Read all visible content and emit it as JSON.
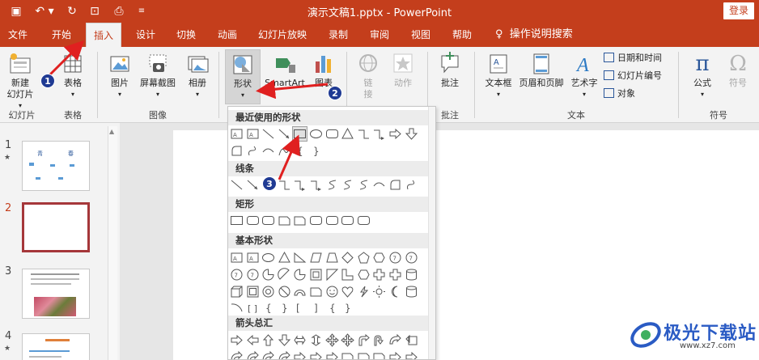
{
  "app": {
    "document_title": "演示文稿1.pptx  -  PowerPoint",
    "login_label": "登录"
  },
  "tabs": [
    "文件",
    "开始",
    "插入",
    "设计",
    "切换",
    "动画",
    "幻灯片放映",
    "录制",
    "审阅",
    "视图",
    "帮助"
  ],
  "tell_me": "操作说明搜索",
  "ribbon": {
    "new_slide": "新建\n幻灯片",
    "table": "表格",
    "picture": "图片",
    "screenshot": "屏幕截图",
    "album": "相册",
    "shapes": "形状",
    "smartart": "SmartArt",
    "chart": "图表",
    "link": "链\n接",
    "action": "动作",
    "comment": "批注",
    "textbox": "文本框",
    "header_footer": "页眉和页脚",
    "wordart": "艺术字",
    "date_time": "日期和时间",
    "slide_number": "幻灯片编号",
    "object": "对象",
    "equation": "公式",
    "symbol": "符号",
    "groups": {
      "slides": "幻灯片",
      "tables": "表格",
      "images": "图像",
      "comments": "批注",
      "text": "文本",
      "symbols": "符号"
    }
  },
  "gallery": {
    "sections": [
      "最近使用的形状",
      "线条",
      "矩形",
      "基本形状",
      "箭头总汇"
    ]
  },
  "thumbnails": {
    "numbers": [
      "1",
      "2",
      "3",
      "4"
    ],
    "slide1_texts": [
      "青",
      "春"
    ]
  },
  "annotations": [
    "1",
    "2",
    "3"
  ],
  "watermark": {
    "main": "极光下载站",
    "sub": "www.xz7.com"
  },
  "colors": {
    "accent": "#c43e1c",
    "annotation_arrow": "#e02020",
    "badge": "#1f3a93"
  }
}
